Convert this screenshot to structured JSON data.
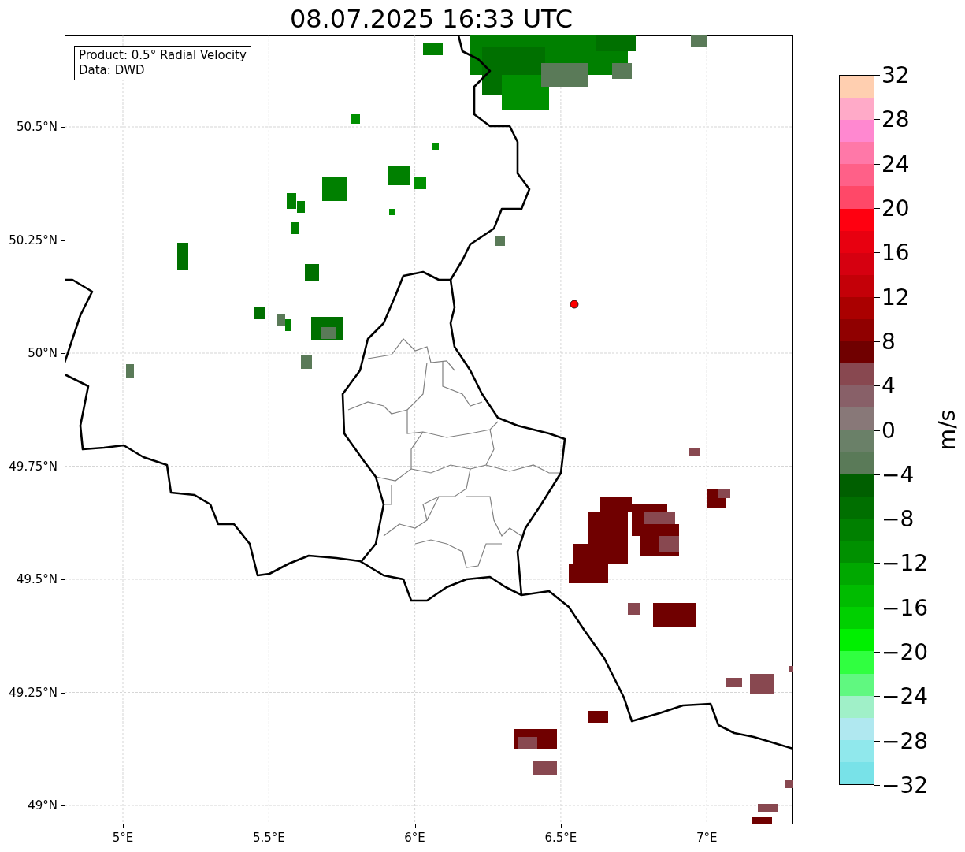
{
  "title": "08.07.2025 16:33 UTC",
  "info_box": [
    "Product: 0.5° Radial Velocity",
    "Data: DWD"
  ],
  "x_tick_labels": [
    "5°E",
    "5.5°E",
    "6°E",
    "6.5°E",
    "7°E"
  ],
  "y_tick_labels": [
    "50.5°N",
    "50.25°N",
    "50°N",
    "49.75°N",
    "49.5°N",
    "49.25°N",
    "49°N"
  ],
  "colorbar": {
    "label": "m/s",
    "tick_labels": [
      "32",
      "28",
      "24",
      "20",
      "16",
      "12",
      "8",
      "4",
      "0",
      "−4",
      "−8",
      "−12",
      "−16",
      "−20",
      "−24",
      "−28",
      "−32"
    ]
  }
}
